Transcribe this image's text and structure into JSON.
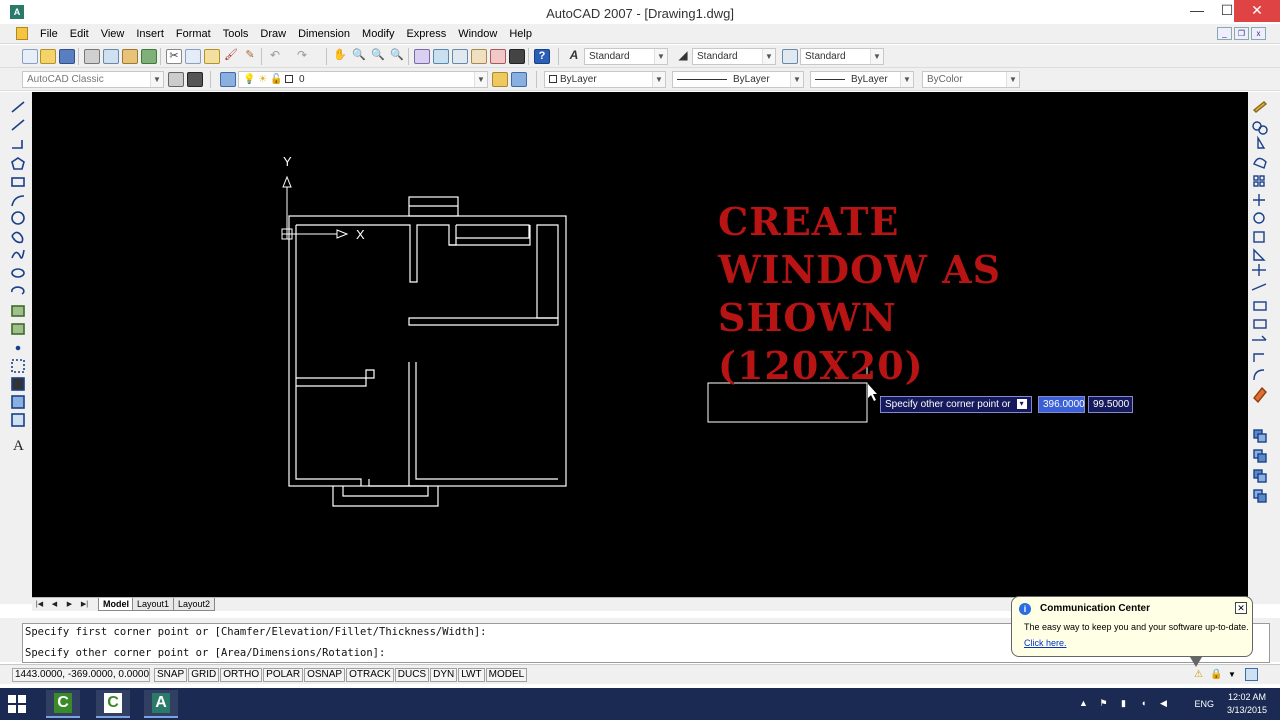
{
  "window": {
    "title": "AutoCAD 2007 - [Drawing1.dwg]",
    "app_icon_text": "A",
    "minimize": "—",
    "maximize": "☐",
    "close": "✕"
  },
  "menubar": {
    "items": [
      "File",
      "Edit",
      "View",
      "Insert",
      "Format",
      "Tools",
      "Draw",
      "Dimension",
      "Modify",
      "Express",
      "Window",
      "Help"
    ]
  },
  "toolbar2": {
    "text_style": "Standard",
    "dim_style": "Standard",
    "table_style": "Standard"
  },
  "toolbar3": {
    "workspace": "AutoCAD Classic",
    "layer": "0",
    "color": "ByLayer",
    "linetype": "ByLayer",
    "lineweight": "ByLayer",
    "plotstyle": "ByColor"
  },
  "canvas": {
    "ucs_y": "Y",
    "ucs_x": "X",
    "overlay_lines": [
      "CREATE",
      "WINDOW AS",
      "SHOWN",
      "(120X20)"
    ],
    "dyn_prompt": "Specify other corner point or",
    "dyn_value_1": "396.0000",
    "dyn_value_2": "99.5000",
    "colors": {
      "background": "#000000",
      "lines": "#ffffff",
      "overlay": "#b81414"
    }
  },
  "layout_tabs": {
    "nav": [
      "|◀",
      "◀",
      "▶",
      "▶|"
    ],
    "tabs": [
      "Model",
      "Layout1",
      "Layout2"
    ],
    "active": "Model"
  },
  "command": {
    "line1": "Specify first corner point or [Chamfer/Elevation/Fillet/Thickness/Width]:",
    "line2": "Specify other corner point or [Area/Dimensions/Rotation]:"
  },
  "status": {
    "coordinates": "1443.0000, -369.0000, 0.0000",
    "buttons": [
      "SNAP",
      "GRID",
      "ORTHO",
      "POLAR",
      "OSNAP",
      "OTRACK",
      "DUCS",
      "DYN",
      "LWT",
      "MODEL"
    ]
  },
  "comm_center": {
    "title": "Communication Center",
    "body": "The easy way to keep you and your software up-to-date.",
    "link": "Click here.",
    "info_glyph": "i",
    "close": "✕"
  },
  "taskbar": {
    "apps": [
      "C",
      "C",
      "A"
    ],
    "lang": "ENG",
    "time": "12:02 AM",
    "date": "3/13/2015"
  }
}
